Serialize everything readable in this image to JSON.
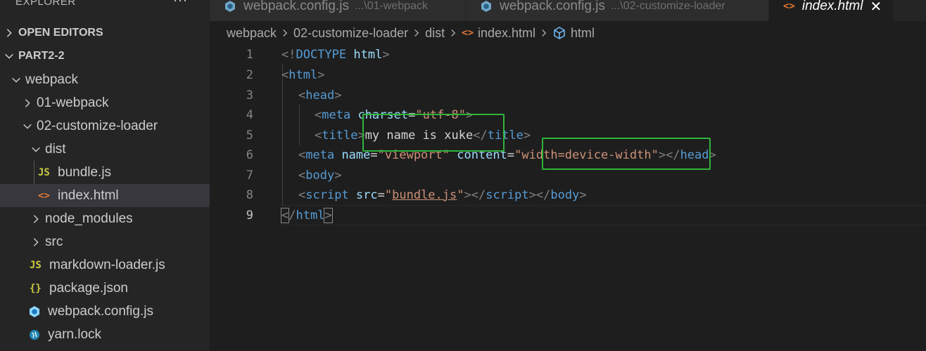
{
  "sidebar": {
    "title": "EXPLORER",
    "more": "···",
    "sections": [
      {
        "label": "OPEN EDITORS"
      },
      {
        "label": "PART2-2"
      }
    ],
    "tree": [
      {
        "label": "webpack"
      },
      {
        "label": "01-webpack"
      },
      {
        "label": "02-customize-loader"
      },
      {
        "label": "dist"
      },
      {
        "label": "bundle.js",
        "icon": "JS"
      },
      {
        "label": "index.html",
        "icon": "<>"
      },
      {
        "label": "node_modules"
      },
      {
        "label": "src"
      },
      {
        "label": "markdown-loader.js",
        "icon": "JS"
      },
      {
        "label": "package.json",
        "icon": "{}"
      },
      {
        "label": "webpack.config.js"
      },
      {
        "label": "yarn.lock"
      }
    ]
  },
  "tabs": [
    {
      "label": "webpack.config.js",
      "desc": "...\\01-webpack"
    },
    {
      "label": "webpack.config.js",
      "desc": "...\\02-customize-loader"
    },
    {
      "label": "index.html",
      "close": "✕"
    }
  ],
  "breadcrumb": {
    "items": [
      "webpack",
      "02-customize-loader",
      "dist",
      "index.html",
      "html"
    ]
  },
  "editor": {
    "line_numbers": [
      "1",
      "2",
      "3",
      "4",
      "5",
      "6",
      "7",
      "8",
      "9"
    ],
    "tokens": {
      "l1_a": "<!",
      "l1_b": "DOCTYPE",
      "l1_c": " html",
      "l1_d": ">",
      "l2_a": "<",
      "l2_b": "html",
      "l2_c": ">",
      "l3_a": "<",
      "l3_b": "head",
      "l3_c": ">",
      "l4_a": "<",
      "l4_b": "meta",
      "l4_c": " charset",
      "l4_d": "=",
      "l4_e": "\"utf-8\"",
      "l4_f": ">",
      "l5_a": "<",
      "l5_b": "title",
      "l5_c": ">",
      "l5_d": "my name is xuke",
      "l5_e": "</",
      "l5_f": "title",
      "l5_g": ">",
      "l6_a": "<",
      "l6_b": "meta",
      "l6_c": " name",
      "l6_d": "=",
      "l6_e": "\"viewport\"",
      "l6_f": " content",
      "l6_g": "=",
      "l6_h": "\"width=device-width\"",
      "l6_i": "></",
      "l6_j": "head",
      "l6_k": ">",
      "l7_a": "<",
      "l7_b": "body",
      "l7_c": ">",
      "l8_a": "<",
      "l8_b": "script",
      "l8_c": " src",
      "l8_d": "=",
      "l8_e": "\"",
      "l8_f": "bundle.js",
      "l8_g": "\"",
      "l8_h": "></",
      "l8_i": "script",
      "l8_j": "></",
      "l8_k": "body",
      "l8_l": ">",
      "l9_a": "<",
      "l9_b": "/",
      "l9_c": "html",
      "l9_d": ">"
    }
  },
  "colors": {
    "highlight_box": "#2fb43a",
    "tag": "#569cd6",
    "attribute": "#9cdcfe",
    "string": "#ce9178"
  }
}
